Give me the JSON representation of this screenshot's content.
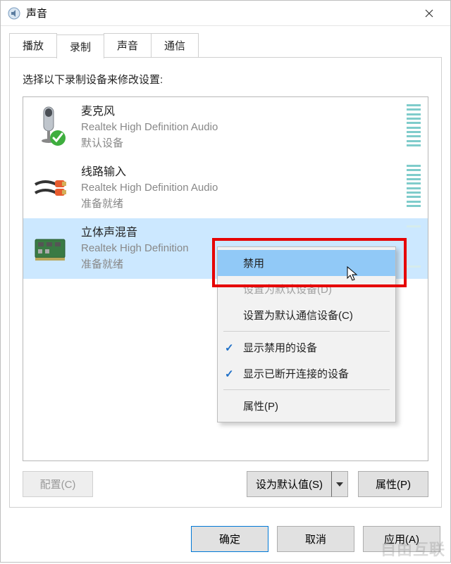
{
  "window": {
    "title": "声音"
  },
  "tabs": {
    "play": "播放",
    "record": "录制",
    "sound": "声音",
    "comm": "通信"
  },
  "desc": "选择以下录制设备来修改设置:",
  "devices": [
    {
      "name": "麦克风",
      "driver": "Realtek High Definition Audio",
      "status": "默认设备"
    },
    {
      "name": "线路输入",
      "driver": "Realtek High Definition Audio",
      "status": "准备就绪"
    },
    {
      "name": "立体声混音",
      "driver": "Realtek High Definition",
      "status": "准备就绪"
    }
  ],
  "ctx": {
    "disable": "禁用",
    "set_default": "设置为默认设备(D)",
    "set_default_comm": "设置为默认通信设备(C)",
    "show_disabled": "显示禁用的设备",
    "show_disconnected": "显示已断开连接的设备",
    "properties": "属性(P)"
  },
  "buttons": {
    "configure": "配置(C)",
    "set_default_value": "设为默认值(S)",
    "properties": "属性(P)",
    "ok": "确定",
    "cancel": "取消",
    "apply": "应用(A)"
  },
  "watermark": "自由互联"
}
